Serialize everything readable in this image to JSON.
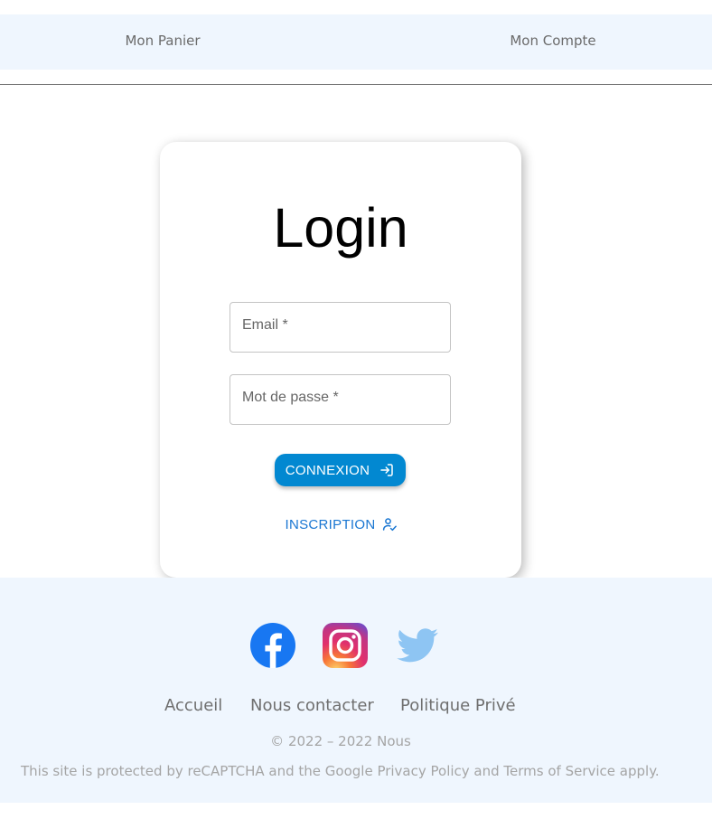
{
  "nav": {
    "cart": "Mon Panier",
    "account": "Mon Compte"
  },
  "login": {
    "title": "Login",
    "email_label": "Email *",
    "password_label": "Mot de passe *",
    "email_value": "",
    "password_value": "",
    "submit_label": "CONNEXION",
    "submit_icon": "login-icon",
    "signup_label": "INSCRIPTION",
    "signup_icon": "how-to-reg-icon"
  },
  "footer": {
    "social": [
      {
        "name": "Facebook",
        "icon": "facebook-icon"
      },
      {
        "name": "Instagram",
        "icon": "instagram-icon"
      },
      {
        "name": "Twitter",
        "icon": "twitter-icon"
      }
    ],
    "links": [
      "Accueil",
      "Nous contacter",
      "Politique Privé"
    ],
    "copyright": "© 2022 – 2022 Nous",
    "recaptcha": "This site is protected by reCAPTCHA and the Google Privacy Policy and Terms of Service apply."
  },
  "colors": {
    "nav_background": "#eff6fe",
    "primary_button": "#0288d1",
    "link_blue": "#1976d2",
    "facebook": "#1877f2",
    "twitter": "#8ec5f3"
  }
}
